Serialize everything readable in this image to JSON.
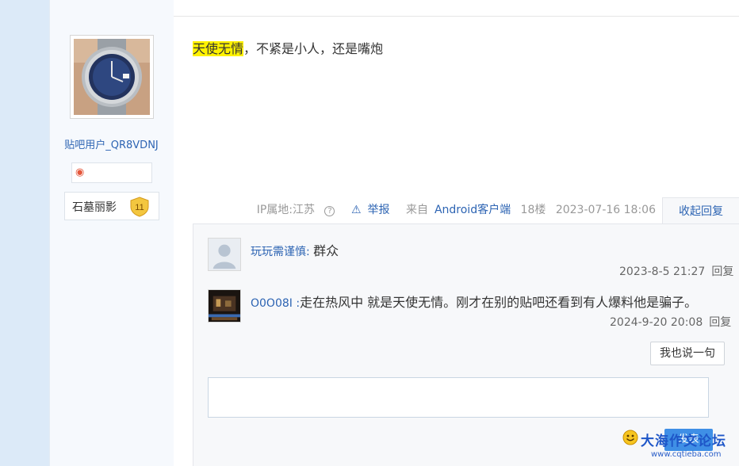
{
  "author": {
    "username": "贴吧用户_QR8VDNJ",
    "badge_icon": "fire-badge-icon",
    "level_title": "石墓丽影",
    "level_number": "11"
  },
  "post": {
    "highlight": "天使无情",
    "text": "，不紧是小人，还是嘴炮"
  },
  "meta": {
    "ip_label": "IP属地:江苏",
    "report_label": "举报",
    "client_prefix": "来自",
    "client_name": "Android客户端",
    "floor": "18楼",
    "time": "2023-07-16 18:06",
    "collapse_label": "收起回复"
  },
  "replies": [
    {
      "user": "玩玩需谨慎",
      "sep": ": ",
      "text": "群众",
      "time": "2023-8-5 21:27",
      "reply_label": "回复"
    },
    {
      "user": "O0O08I",
      "sep": " :",
      "text": "走在热风中 就是天使无情。刚才在别的贴吧还看到有人爆料他是骗子。",
      "time": "2024-9-20 20:08",
      "reply_label": "回复"
    }
  ],
  "actions": {
    "say_label": "我也说一句",
    "send_label": "发表"
  },
  "watermark": {
    "title": "大海作文论坛",
    "url": "www.cqtieba.com"
  },
  "colors": {
    "link": "#2d64b3",
    "highlight": "#fff200",
    "send_button": "#3f8fe6"
  }
}
